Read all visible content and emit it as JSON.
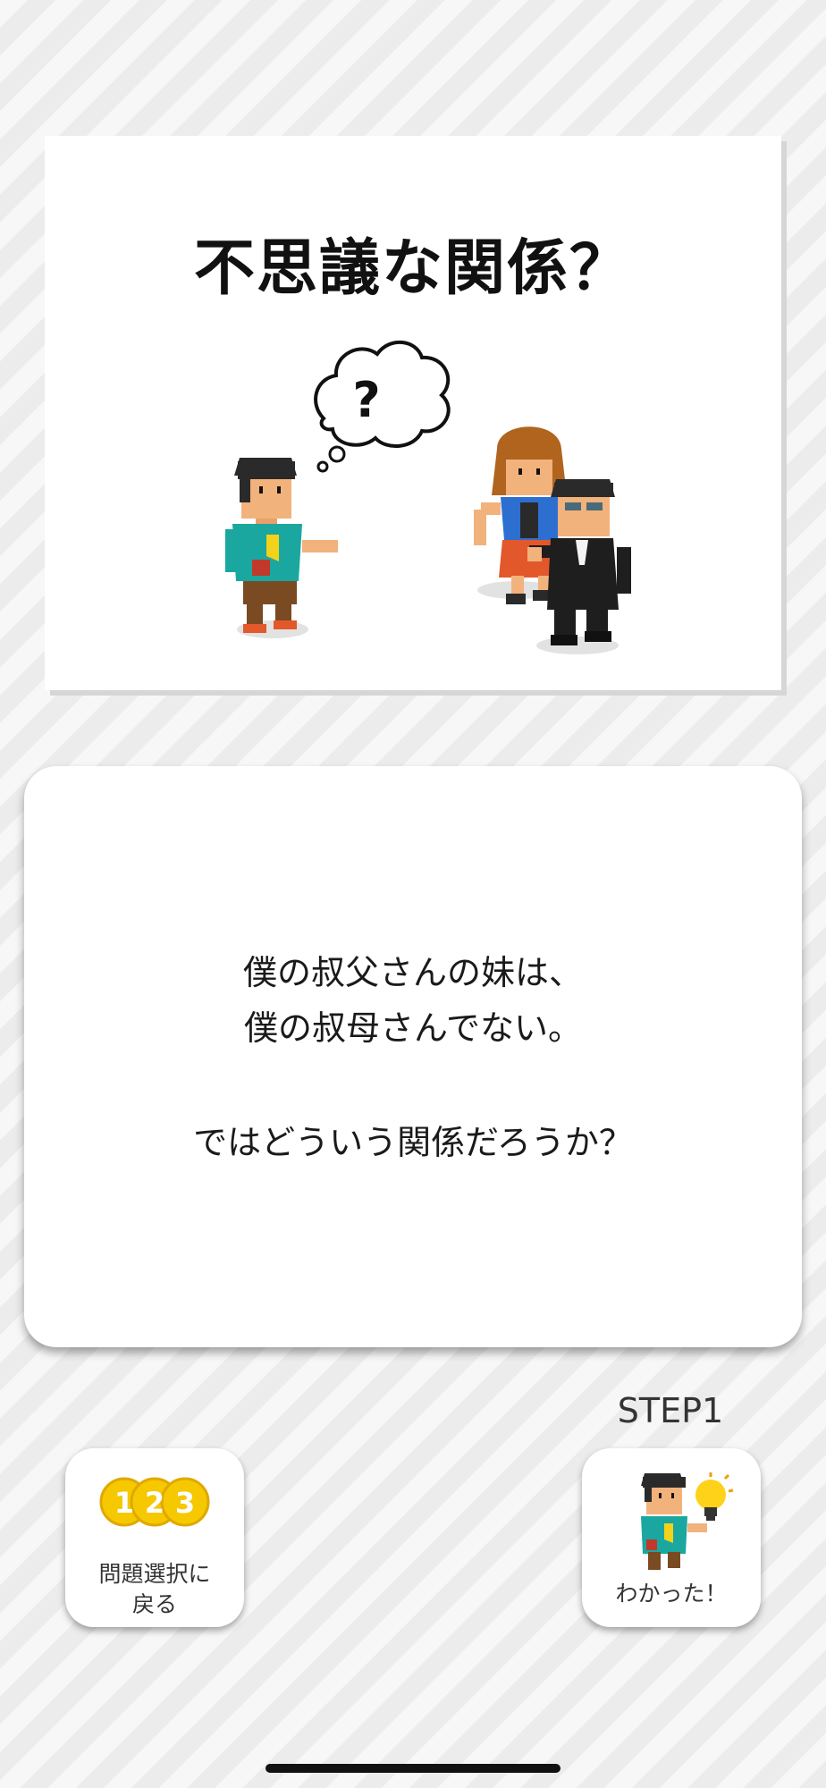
{
  "title_card": {
    "title": "不思議な関係？",
    "thought_bubble_text": "?"
  },
  "question": {
    "line1": "僕の叔父さんの妹は、",
    "line2": "僕の叔母さんでない。",
    "line3": "ではどういう関係だろうか？"
  },
  "step_label": "STEP1",
  "back_button": {
    "icon": "number-coins-icon",
    "coin1": "1",
    "coin2": "2",
    "coin3": "3",
    "line1": "問題選択に",
    "line2": "戻る"
  },
  "ok_button": {
    "icon": "boy-lightbulb-icon",
    "label": "わかった！"
  },
  "colors": {
    "teal_shirt": "#1aa7a0",
    "coin_gold": "#f5c800",
    "bulb_yellow": "#ffd21a"
  }
}
